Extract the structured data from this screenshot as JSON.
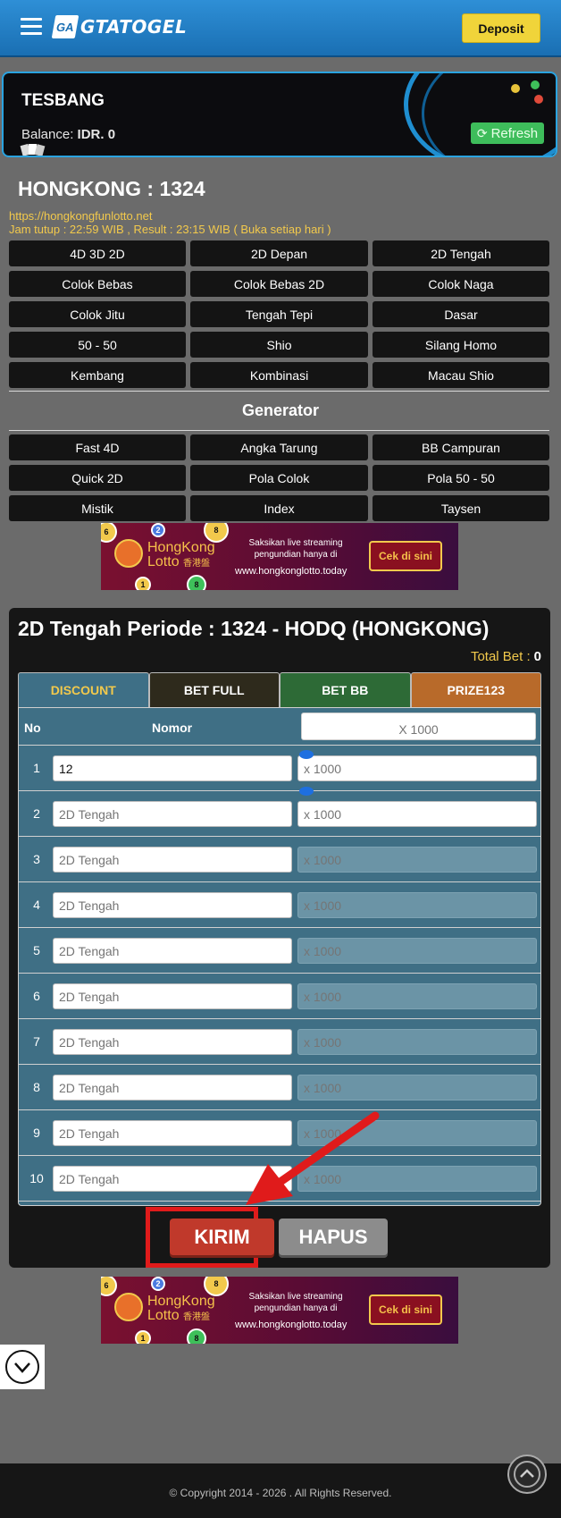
{
  "header": {
    "logo_mark": "GA",
    "logo_text": "GTATOGEL",
    "deposit_label": "Deposit"
  },
  "account": {
    "username": "TESBANG",
    "balance_label": "Balance:",
    "balance_value": "IDR. 0",
    "refresh_label": "Refresh"
  },
  "market": {
    "title": "HONGKONG : 1324",
    "url": "https://hongkongfunlotto.net",
    "hours": "Jam tutup : 22:59 WIB , Result : 23:15 WIB ( Buka setiap hari )"
  },
  "game_buttons": [
    "4D 3D 2D",
    "2D Depan",
    "2D Tengah",
    "Colok Bebas",
    "Colok Bebas 2D",
    "Colok Naga",
    "Colok Jitu",
    "Tengah Tepi",
    "Dasar",
    "50 - 50",
    "Shio",
    "Silang Homo",
    "Kembang",
    "Kombinasi",
    "Macau Shio"
  ],
  "generator": {
    "title": "Generator",
    "buttons": [
      "Fast 4D",
      "Angka Tarung",
      "BB Campuran",
      "Quick 2D",
      "Pola Colok",
      "Pola 50 - 50",
      "Mistik",
      "Index",
      "Taysen"
    ]
  },
  "banner": {
    "brand": "HongKong",
    "brand2": "Lotto",
    "brand_sub": "香港盤",
    "stream_text": "Saksikan live streaming pengundian hanya di",
    "site": "www.hongkonglotto.today",
    "cta": "Cek di sini"
  },
  "bet": {
    "title": "2D Tengah Periode : 1324 - HODQ (HONGKONG)",
    "total_bet_label": "Total Bet :",
    "total_bet_value": "0",
    "tabs": [
      "DISCOUNT",
      "BET FULL",
      "BET BB",
      "PRIZE123"
    ],
    "col_no": "No",
    "col_nomor": "Nomor",
    "bet_all_placeholder": "X 1000",
    "rows": [
      {
        "no": "1",
        "nomor": "12",
        "nomor_placeholder": "2D Tengah",
        "bet_placeholder": "x 1000"
      },
      {
        "no": "2",
        "nomor": "",
        "nomor_placeholder": "2D Tengah",
        "bet_placeholder": "x 1000"
      },
      {
        "no": "3",
        "nomor": "",
        "nomor_placeholder": "2D Tengah",
        "bet_placeholder": "x 1000"
      },
      {
        "no": "4",
        "nomor": "",
        "nomor_placeholder": "2D Tengah",
        "bet_placeholder": "x 1000"
      },
      {
        "no": "5",
        "nomor": "",
        "nomor_placeholder": "2D Tengah",
        "bet_placeholder": "x 1000"
      },
      {
        "no": "6",
        "nomor": "",
        "nomor_placeholder": "2D Tengah",
        "bet_placeholder": "x 1000"
      },
      {
        "no": "7",
        "nomor": "",
        "nomor_placeholder": "2D Tengah",
        "bet_placeholder": "x 1000"
      },
      {
        "no": "8",
        "nomor": "",
        "nomor_placeholder": "2D Tengah",
        "bet_placeholder": "x 1000"
      },
      {
        "no": "9",
        "nomor": "",
        "nomor_placeholder": "2D Tengah",
        "bet_placeholder": "x 1000"
      },
      {
        "no": "10",
        "nomor": "",
        "nomor_placeholder": "2D Tengah",
        "bet_placeholder": "x 1000"
      }
    ],
    "submit_label": "KIRIM",
    "clear_label": "HAPUS"
  },
  "footer": {
    "copyright": "© Copyright 2014 - 2026 . All Rights Reserved."
  },
  "colors": {
    "header_blue": "#1f7fc6",
    "deposit_yellow": "#f0d43a",
    "refresh_green": "#3ebd5b",
    "kirim_red": "#c0392b",
    "highlight_red": "#e01b1b",
    "table_teal": "#3f6f85"
  }
}
